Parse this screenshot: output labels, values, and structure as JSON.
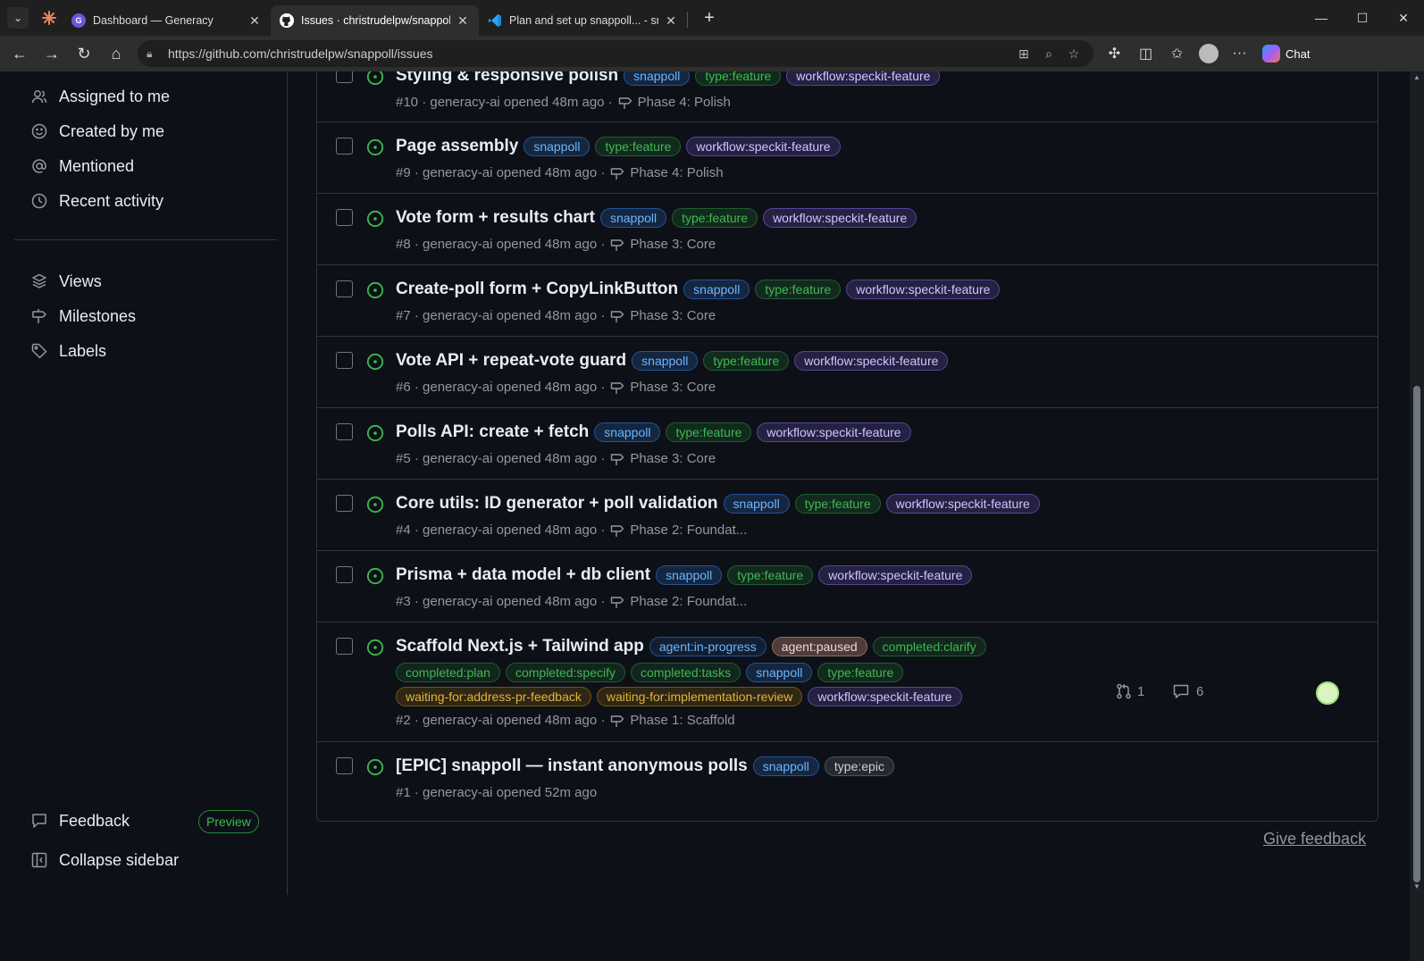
{
  "browser": {
    "tabs": [
      {
        "title": "Dashboard — Generacy",
        "active": false
      },
      {
        "title": "Issues · christrudelpw/snappoll",
        "active": true
      },
      {
        "title": "Plan and set up snappoll... - snapp",
        "active": false
      }
    ],
    "url": "https://github.com/christrudelpw/snappoll/issues",
    "copilot_label": "Chat"
  },
  "sidebar": {
    "items_top": [
      {
        "label": "Assigned to me",
        "icon": "person-icon"
      },
      {
        "label": "Created by me",
        "icon": "smiley-icon"
      },
      {
        "label": "Mentioned",
        "icon": "mention-icon"
      },
      {
        "label": "Recent activity",
        "icon": "clock-icon"
      }
    ],
    "items_mid": [
      {
        "label": "Views",
        "icon": "stack-icon"
      },
      {
        "label": "Milestones",
        "icon": "milestone-icon"
      },
      {
        "label": "Labels",
        "icon": "tag-icon"
      }
    ],
    "feedback_label": "Feedback",
    "preview_badge": "Preview",
    "collapse_label": "Collapse sidebar"
  },
  "issues": [
    {
      "title": "Styling & responsive polish",
      "number": "#10",
      "meta": "· generacy-ai opened 48m ago ·",
      "milestone": "Phase 4: Polish",
      "labels": [
        "snappoll",
        "type:feature",
        "workflow:speckit-feature"
      ]
    },
    {
      "title": "Page assembly",
      "number": "#9",
      "meta": "· generacy-ai opened 48m ago ·",
      "milestone": "Phase 4: Polish",
      "labels": [
        "snappoll",
        "type:feature",
        "workflow:speckit-feature"
      ]
    },
    {
      "title": "Vote form + results chart",
      "number": "#8",
      "meta": "· generacy-ai opened 48m ago ·",
      "milestone": "Phase 3: Core",
      "labels": [
        "snappoll",
        "type:feature",
        "workflow:speckit-feature"
      ]
    },
    {
      "title": "Create-poll form + CopyLinkButton",
      "number": "#7",
      "meta": "· generacy-ai opened 48m ago ·",
      "milestone": "Phase 3: Core",
      "labels": [
        "snappoll",
        "type:feature",
        "workflow:speckit-feature"
      ]
    },
    {
      "title": "Vote API + repeat-vote guard",
      "number": "#6",
      "meta": "· generacy-ai opened 48m ago ·",
      "milestone": "Phase 3: Core",
      "labels": [
        "snappoll",
        "type:feature",
        "workflow:speckit-feature"
      ]
    },
    {
      "title": "Polls API: create + fetch",
      "number": "#5",
      "meta": "· generacy-ai opened 48m ago ·",
      "milestone": "Phase 3: Core",
      "labels": [
        "snappoll",
        "type:feature",
        "workflow:speckit-feature"
      ]
    },
    {
      "title": "Core utils: ID generator + poll validation",
      "number": "#4",
      "meta": "· generacy-ai opened 48m ago ·",
      "milestone": "Phase 2: Foundat...",
      "labels": [
        "snappoll",
        "type:feature",
        "workflow:speckit-feature"
      ]
    },
    {
      "title": "Prisma + data model + db client",
      "number": "#3",
      "meta": "· generacy-ai opened 48m ago ·",
      "milestone": "Phase 2: Foundat...",
      "labels": [
        "snappoll",
        "type:feature",
        "workflow:speckit-feature"
      ]
    },
    {
      "title": "Scaffold Next.js + Tailwind app",
      "number": "#2",
      "meta": "· generacy-ai opened 48m ago ·",
      "milestone": "Phase 1: Scaffold",
      "labels_line1": [
        "agent:in-progress",
        "agent:paused",
        "completed:clarify"
      ],
      "labels_line2": [
        "completed:plan",
        "completed:specify",
        "completed:tasks",
        "snappoll",
        "type:feature"
      ],
      "labels_line3": [
        "waiting-for:address-pr-feedback",
        "waiting-for:implementation-review",
        "workflow:speckit-feature"
      ],
      "pr_count": "1",
      "comment_count": "6"
    },
    {
      "title": "[EPIC] snappoll — instant anonymous polls",
      "number": "#1",
      "meta": "· generacy-ai opened 52m ago",
      "milestone": "",
      "labels": [
        "snappoll",
        "type:epic"
      ]
    }
  ],
  "give_feedback": "Give feedback",
  "colors": {
    "open_issue": "#3fb950",
    "background": "#0d1117",
    "border": "#30363d"
  }
}
